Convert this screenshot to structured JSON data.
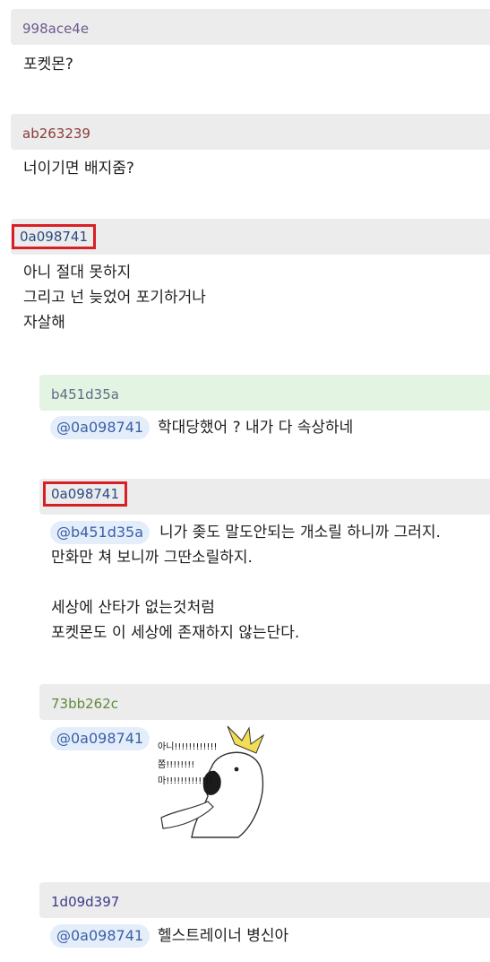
{
  "comments": [
    {
      "author": "998ace4e",
      "author_color": "#6d5a8e",
      "text": "포켓몬?"
    },
    {
      "author": "ab263239",
      "author_color": "#8a3b3b",
      "text": "너이기면 배지줌?"
    },
    {
      "author": "0a098741",
      "author_color": "#2a4a86",
      "text": "아니 절대 못하지\n그리고 넌 늦었어 포기하거나\n자살해"
    }
  ],
  "replies": [
    {
      "author": "b451d35a",
      "author_color": "#5d6d86",
      "mention": "@0a098741",
      "text": "학대당했어 ? 내가 다 속상하네"
    },
    {
      "author": "0a098741",
      "author_color": "#2a4a86",
      "mention": "@b451d35a",
      "text": "니가 좆도 말도안되는 개소릴 하니까 그러지.\n만화만 쳐 보니까 그딴소릴하지.\n\n세상에 산타가 없는것처럼\n포켓몬도 이 세상에 존재하지 않는단다."
    },
    {
      "author": "73bb262c",
      "author_color": "#5e8a3a",
      "mention": "@0a098741",
      "image_text": [
        "아니!!!!!!!!!!!!",
        "쫌!!!!!!!!",
        "마!!!!!!!!!!!!!"
      ]
    },
    {
      "author": "1d09d397",
      "author_color": "#3b3b8a",
      "mention": "@0a098741",
      "text": "헬스트레이너 병신아"
    }
  ]
}
